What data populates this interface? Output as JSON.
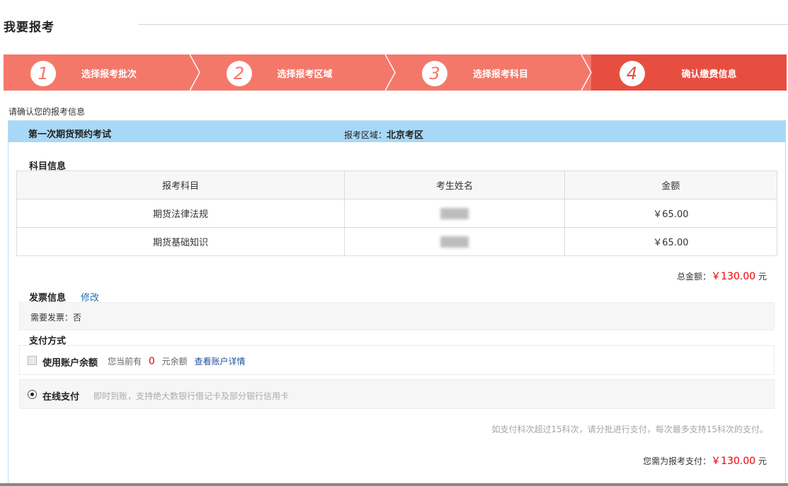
{
  "header": {
    "title": "我要报考"
  },
  "steps": [
    {
      "num": "1",
      "label": "选择报考批次"
    },
    {
      "num": "2",
      "label": "选择报考区域"
    },
    {
      "num": "3",
      "label": "选择报考科目"
    },
    {
      "num": "4",
      "label": "确认缴费信息"
    }
  ],
  "confirm_text": "请确认您的报考信息",
  "exam": {
    "name": "第一次期货预约考试",
    "region_label": "报考区域：",
    "region_value": "北京考区"
  },
  "subjects": {
    "section_title": "科目信息",
    "headers": [
      "报考科目",
      "考生姓名",
      "金额"
    ],
    "rows": [
      {
        "subject": "期货法律法规",
        "amount": "￥65.00"
      },
      {
        "subject": "期货基础知识",
        "amount": "￥65.00"
      }
    ]
  },
  "total": {
    "label": "总金额：",
    "value": "￥130.00",
    "unit": " 元"
  },
  "invoice": {
    "section_title": "发票信息",
    "edit_label": "修改",
    "need_invoice": "需要发票：否"
  },
  "payment": {
    "section_title": "支付方式",
    "balance": {
      "label": "使用账户余额",
      "desc_prefix": "您当前有",
      "amount": "0",
      "desc_suffix": "元余额",
      "detail_link": "查看账户详情"
    },
    "online": {
      "label": "在线支付",
      "desc": "即时到账，支持绝大数银行借记卡及部分银行信用卡"
    }
  },
  "note": "如支付科次超过15科次，请分批进行支付，每次最多支持15科次的支付。",
  "final": {
    "label": "您需为报考支付：",
    "value": "￥130.00",
    "unit": " 元"
  },
  "colors": {
    "step_bg": "#f4786a",
    "step_active_bg": "#e84e40",
    "exam_header_bg": "#a8d8f7",
    "money": "#ee0000",
    "link": "#1f6fb5"
  }
}
